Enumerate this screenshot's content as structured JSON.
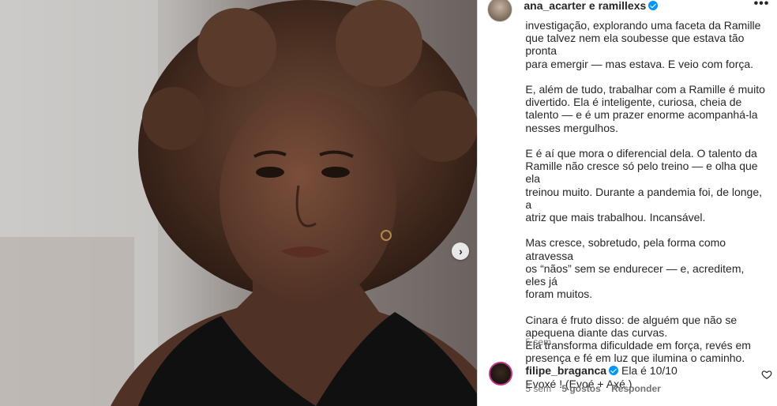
{
  "post": {
    "header_user": "ana_acarter e ramillexs",
    "caption_paragraphs": [
      "investigação, explorando uma faceta da Ramille\nque talvez nem ela soubesse que estava tão pronta\npara emergir — mas estava. E veio com força.",
      "E, além de tudo, trabalhar com a Ramille é muito\ndivertido. Ela é inteligente, curiosa, cheia de\ntalento — e é um prazer enorme acompanhá-la\nnesses mergulhos.",
      "E é aí que mora o diferencial dela. O talento da\nRamille não cresce só pelo treino — e olha que ela\ntreinou muito. Durante a pandemia foi, de longe, a\natriz que mais trabalhou. Incansável.",
      "Mas cresce, sobretudo, pela forma como atravessa\nos “nãos” sem se endurecer — e, acreditem, eles já\nforam muitos.",
      "Cinara é fruto disso: de alguém que não se\napequena diante das curvas.\nEla transforma dificuldade em força, revés em\npresença e fé em luz que ilumina o caminho.",
      "Evoxé ! (Evoé + Axé )"
    ],
    "caption_time": "5 sem"
  },
  "comment": {
    "user": "filipe_braganca",
    "text": "Ela é 10/10",
    "time": "5 sem",
    "likes": "5 gostos",
    "reply": "Responder"
  },
  "icons": {
    "verified": "verified-badge-icon",
    "more": "more-options-icon",
    "next": "chevron-right-icon",
    "like": "heart-icon"
  },
  "colors": {
    "verified": "#0095f6",
    "text": "#262626",
    "secondary": "#737373"
  }
}
